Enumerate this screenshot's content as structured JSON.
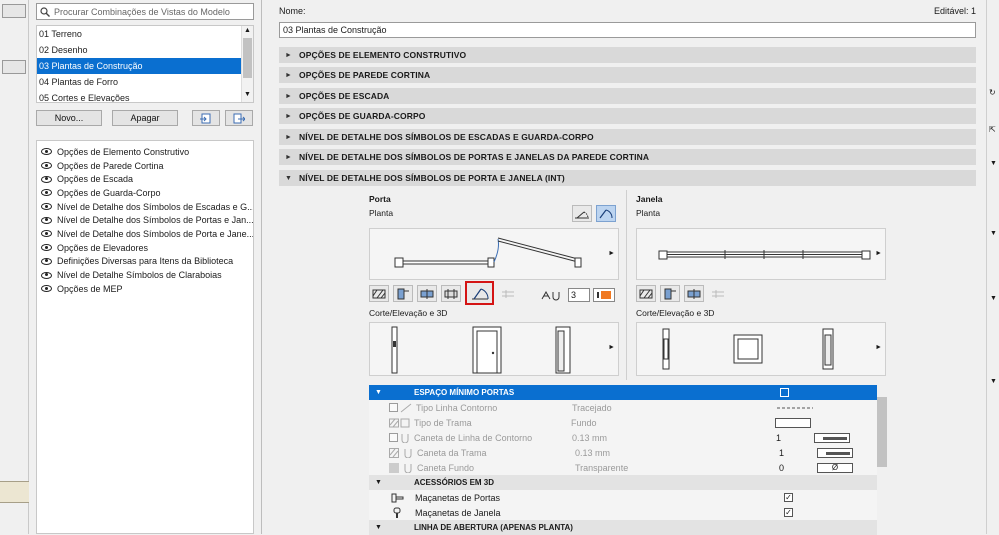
{
  "search": {
    "placeholder": "Procurar Combinações de Vistas do Modelo"
  },
  "combinations": [
    {
      "label": "01 Terreno",
      "selected": false
    },
    {
      "label": "02 Desenho",
      "selected": false
    },
    {
      "label": "03 Plantas de Construção",
      "selected": true
    },
    {
      "label": "04 Plantas de Forro",
      "selected": false
    },
    {
      "label": "05 Cortes e Elevações",
      "selected": false
    }
  ],
  "buttons": {
    "new": "Novo...",
    "delete": "Apagar"
  },
  "options": [
    "Opções de Elemento Construtivo",
    "Opções de Parede Cortina",
    "Opções de Escada",
    "Opções de Guarda-Corpo",
    "Nível de Detalhe dos Símbolos de Escadas e G...",
    "Nível de Detalhe dos Símbolos de Portas e Jan...",
    "Nível de Detalhe dos Símbolos de Porta e Jane...",
    "Opções de Elevadores",
    "Definições Diversas para Itens da Biblioteca",
    "Nível de Detalhe Símbolos de Claraboias",
    "Opções de MEP"
  ],
  "header": {
    "name_label": "Nome:",
    "editable": "Editável: 1",
    "name_value": "03 Plantas de Construção"
  },
  "sections": [
    "OPÇÕES DE ELEMENTO CONSTRUTIVO",
    "OPÇÕES DE PAREDE CORTINA",
    "OPÇÕES DE ESCADA",
    "OPÇÕES DE GUARDA-CORPO",
    "NÍVEL DE DETALHE DOS SÍMBOLOS DE ESCADAS E GUARDA-CORPO",
    "NÍVEL DE DETALHE DOS SÍMBOLOS DE PORTAS E JANELAS DA PAREDE CORTINA",
    "NÍVEL DE DETALHE DOS SÍMBOLOS DE PORTA E JANELA (INT)"
  ],
  "door": {
    "title": "Porta",
    "subtitle": "Planta",
    "section": "Corte/Elevação e 3D",
    "count": "3"
  },
  "window": {
    "title": "Janela",
    "subtitle": "Planta",
    "section": "Corte/Elevação e 3D"
  },
  "table": {
    "hdr1": "ESPAÇO MÍNIMO PORTAS",
    "rows": [
      {
        "label": "Tipo Linha Contorno",
        "value": "Tracejado",
        "num": ""
      },
      {
        "label": "Tipo de Trama",
        "value": "Fundo",
        "num": ""
      },
      {
        "label": "Caneta de Linha de Contorno",
        "value": "0.13 mm",
        "num": "1"
      },
      {
        "label": "Caneta da Trama",
        "value": "0.13 mm",
        "num": "1"
      },
      {
        "label": "Caneta Fundo",
        "value": "Transparente",
        "num": "0"
      }
    ],
    "hdr2": "ACESSÓRIOS EM 3D",
    "acc": [
      {
        "label": "Maçanetas de Portas",
        "checked": true
      },
      {
        "label": "Maçanetas de Janela",
        "checked": true
      }
    ],
    "hdr3": "LINHA DE ABERTURA (APENAS PLANTA)"
  },
  "colors": {
    "selection": "#0a6fd0",
    "highlight": "#d41414",
    "orange": "#f07820"
  }
}
